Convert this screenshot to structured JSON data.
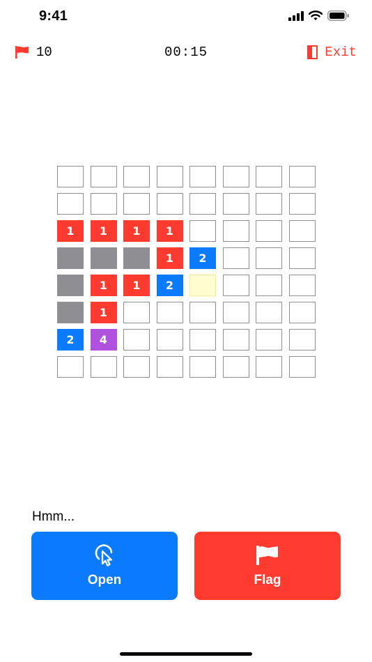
{
  "status_bar": {
    "time": "9:41",
    "icons": [
      "signal-icon",
      "wifi-icon",
      "battery-icon"
    ]
  },
  "header": {
    "flags_remaining": "10",
    "timer": "00:15",
    "exit_label": "Exit",
    "accent": "#ff3b30"
  },
  "board": {
    "rows": 8,
    "cols": 8,
    "cells": [
      [
        "",
        "",
        "",
        "",
        "",
        "",
        "",
        ""
      ],
      [
        "",
        "",
        "",
        "",
        "",
        "",
        "",
        ""
      ],
      [
        "1",
        "1",
        "1",
        "1",
        "",
        "",
        "",
        ""
      ],
      [
        "revealed",
        "revealed",
        "revealed",
        "1",
        "2",
        "",
        "",
        ""
      ],
      [
        "revealed",
        "1",
        "1",
        "2",
        "selected",
        "",
        "",
        ""
      ],
      [
        "revealed",
        "1",
        "",
        "",
        "",
        "",
        "",
        ""
      ],
      [
        "2",
        "4",
        "",
        "",
        "",
        "",
        "",
        ""
      ],
      [
        "",
        "",
        "",
        "",
        "",
        "",
        "",
        ""
      ]
    ],
    "colors": {
      "1": "#ff3b30",
      "2": "#0a7aff",
      "4": "#af52de",
      "revealed": "#8e8e93",
      "selected": "#fffccf"
    }
  },
  "hint_text": "Hmm...",
  "actions": {
    "open_label": "Open",
    "open_icon": "tap-cursor-icon",
    "open_color": "#0a7aff",
    "flag_label": "Flag",
    "flag_icon": "flag-icon",
    "flag_color": "#ff3b30"
  }
}
